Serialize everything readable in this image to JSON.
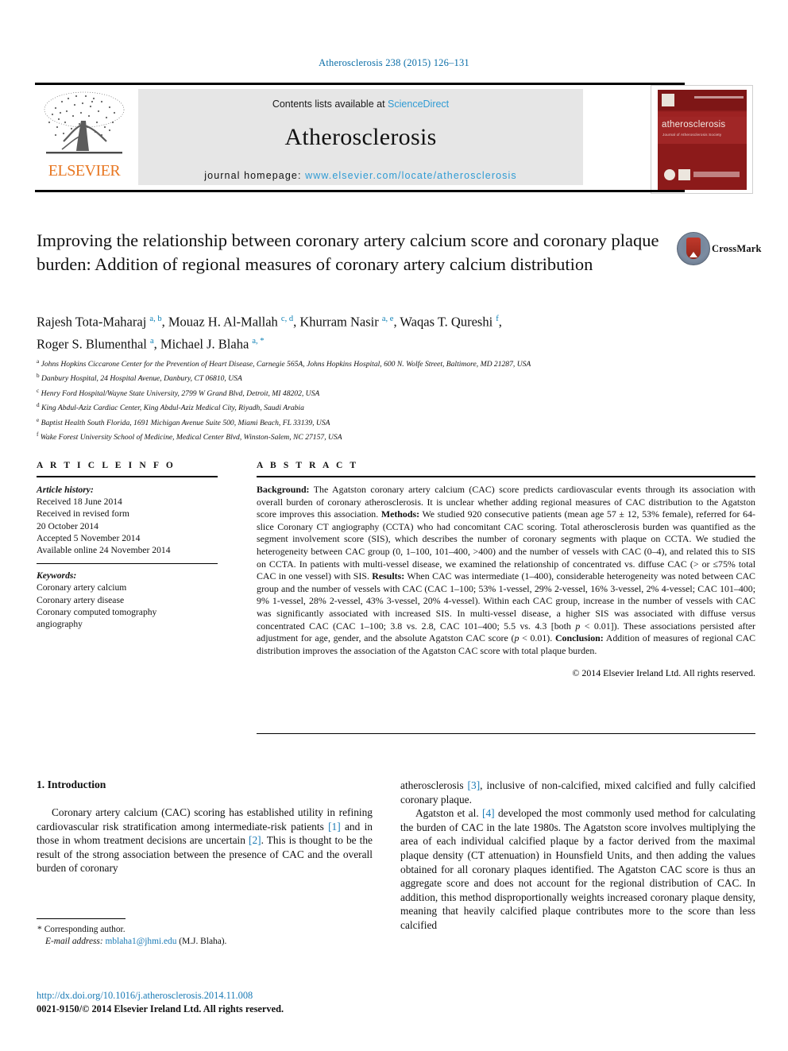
{
  "running_head": "Atherosclerosis 238 (2015) 126–131",
  "banner": {
    "publisher_logo_name": "ELSEVIER",
    "contents_prefix": "Contents lists available at",
    "contents_link": "ScienceDirect",
    "journal_name": "Atherosclerosis",
    "homepage_prefix": "journal homepage:",
    "homepage_url": "www.elsevier.com/locate/atherosclerosis",
    "cover": {
      "title": "atherosclerosis",
      "subtitle": "Journal of Atherosclerosis Society"
    }
  },
  "article": {
    "title": "Improving the relationship between coronary artery calcium score and coronary plaque burden: Addition of regional measures of coronary artery calcium distribution",
    "crossmark_label": "CrossMark",
    "authors_line_1": "Rajesh Tota-Maharaj <sup>a, b</sup>, Mouaz H. Al-Mallah <sup>c, d</sup>, Khurram Nasir <sup>a, e</sup>, Waqas T. Qureshi <sup>f</sup>,",
    "authors_line_2": "Roger S. Blumenthal <sup>a</sup>, Michael J. Blaha <sup>a, *</sup>",
    "affiliations": [
      "<sup>a</sup> Johns Hopkins Ciccarone Center for the Prevention of Heart Disease, Carnegie 565A, Johns Hopkins Hospital, 600 N. Wolfe Street, Baltimore, MD 21287, USA",
      "<sup>b</sup> Danbury Hospital, 24 Hospital Avenue, Danbury, CT 06810, USA",
      "<sup>c</sup> Henry Ford Hospital/Wayne State University, 2799 W Grand Blvd, Detroit, MI 48202, USA",
      "<sup>d</sup> King Abdul-Aziz Cardiac Center, King Abdul-Aziz Medical City, Riyadh, Saudi Arabia",
      "<sup>e</sup> Baptist Health South Florida, 1691 Michigan Avenue Suite 500, Miami Beach, FL 33139, USA",
      "<sup>f</sup> Wake Forest University School of Medicine, Medical Center Blvd, Winston-Salem, NC 27157, USA"
    ]
  },
  "article_info": {
    "heading": "A R T I C L E  I N F O",
    "history_label": "Article history:",
    "history": [
      "Received 18 June 2014",
      "Received in revised form",
      "20 October 2014",
      "Accepted 5 November 2014",
      "Available online 24 November 2014"
    ],
    "keywords_label": "Keywords:",
    "keywords": [
      "Coronary artery calcium",
      "Coronary artery disease",
      "Coronary computed tomography",
      "angiography"
    ]
  },
  "abstract": {
    "heading": "A B S T R A C T",
    "html": "<b>Background:</b> The Agatston coronary artery calcium (CAC) score predicts cardiovascular events through its association with overall burden of coronary atherosclerosis. It is unclear whether adding regional measures of CAC distribution to the Agatston score improves this association. <b>Methods:</b> We studied 920 consecutive patients (mean age 57 ± 12, 53% female), referred for 64-slice Coronary CT angiography (CCTA) who had concomitant CAC scoring. Total atherosclerosis burden was quantified as the segment involvement score (SIS), which describes the number of coronary segments with plaque on CCTA. We studied the heterogeneity between CAC group (0, 1–100, 101–400, &gt;400) and the number of vessels with CAC (0–4), and related this to SIS on CCTA. In patients with multi-vessel disease, we examined the relationship of concentrated vs. diffuse CAC (&gt; or ≤75% total CAC in one vessel) with SIS. <b>Results:</b> When CAC was intermediate (1–400), considerable heterogeneity was noted between CAC group and the number of vessels with CAC (CAC 1–100; 53% 1-vessel, 29% 2-vessel, 16% 3-vessel, 2% 4-vessel; CAC 101–400; 9% 1-vessel, 28% 2-vessel, 43% 3-vessel, 20% 4-vessel). Within each CAC group, increase in the number of vessels with CAC was significantly associated with increased SIS. In multi-vessel disease, a higher SIS was associated with diffuse versus concentrated CAC (CAC 1–100; 3.8 vs. 2.8, CAC 101–400; 5.5 vs. 4.3 [both <i>p</i> &lt; 0.01]). These associations persisted after adjustment for age, gender, and the absolute Agatston CAC score (<i>p</i> &lt; 0.01). <b>Conclusion:</b> Addition of measures of regional CAC distribution improves the association of the Agatston CAC score with total plaque burden.",
    "copyright": "© 2014 Elsevier Ireland Ltd. All rights reserved."
  },
  "introduction": {
    "heading": "1. Introduction",
    "left_paragraph_html": "Coronary artery calcium (CAC) scoring has established utility in refining cardiovascular risk stratification among intermediate-risk patients <span class=\"ref\">[1]</span> and in those in whom treatment decisions are uncertain <span class=\"ref\">[2]</span>. This is thought to be the result of the strong association between the presence of CAC and the overall burden of coronary",
    "right_paragraph_1_html": "atherosclerosis <span class=\"ref\">[3]</span>, inclusive of non-calcified, mixed calcified and fully calcified coronary plaque.",
    "right_paragraph_2_html": "Agatston et al. <span class=\"ref\">[4]</span> developed the most commonly used method for calculating the burden of CAC in the late 1980s. The Agatston score involves multiplying the area of each individual calcified plaque by a factor derived from the maximal plaque density (CT attenuation) in Hounsfield Units, and then adding the values obtained for all coronary plaques identified. The Agatston CAC score is thus an aggregate score and does not account for the regional distribution of CAC. In addition, this method disproportionally weights increased coronary plaque density, meaning that heavily calcified plaque contributes more to the score than less calcified"
  },
  "footer": {
    "corresponding_marker": "*",
    "corresponding_author": "Corresponding author.",
    "email_label": "E-mail address:",
    "email": "mblaha1@jhmi.edu",
    "email_owner": "(M.J. Blaha).",
    "doi": "http://dx.doi.org/10.1016/j.atherosclerosis.2014.11.008",
    "issn_line": "0021-9150/© 2014 Elsevier Ireland Ltd. All rights reserved."
  },
  "colors": {
    "link_blue": "#1a7ab5",
    "sciencedirect_blue": "#2f9bd4",
    "elsevier_orange": "#E87722",
    "cover_red": "#8e1c1c"
  }
}
